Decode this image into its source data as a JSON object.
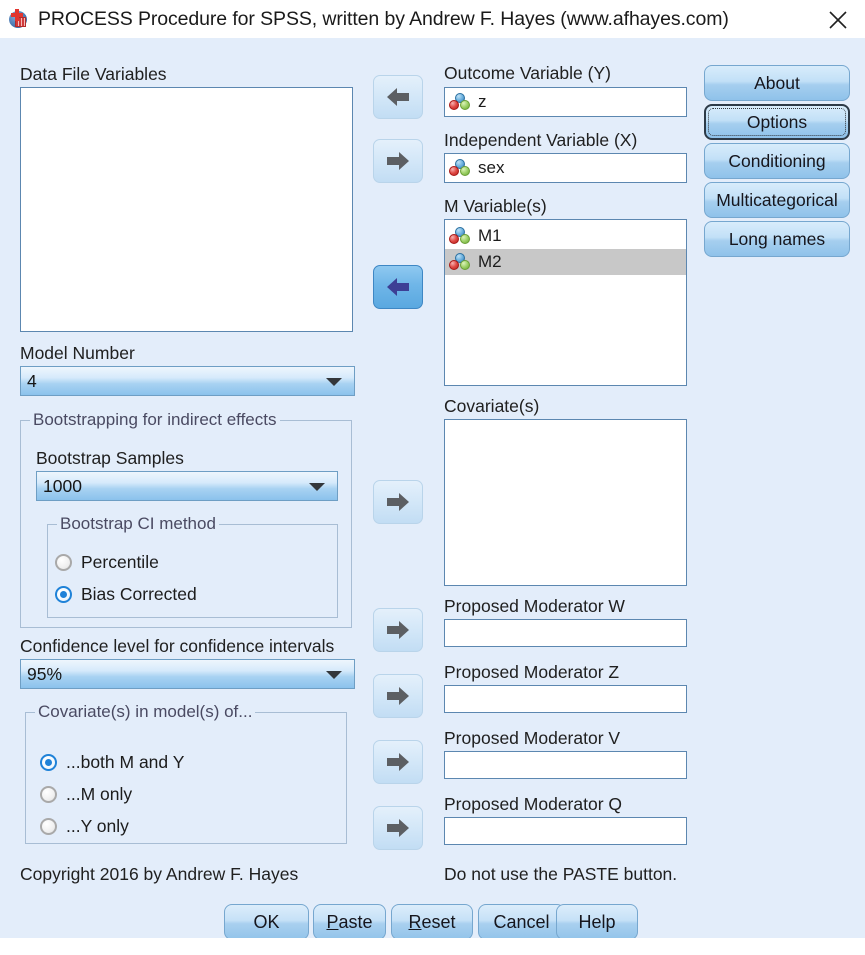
{
  "window": {
    "title": "PROCESS Procedure for SPSS, written by Andrew F. Hayes (www.afhayes.com)",
    "app_icon": "spss-app-icon",
    "close_icon": "close-icon"
  },
  "left_panel": {
    "data_file_variables_label": "Data File Variables",
    "data_file_variables_items": [],
    "model_number_label": "Model Number",
    "model_number_value": "4",
    "bootstrapping_group_label": "Bootstrapping for indirect effects",
    "bootstrap_samples_label": "Bootstrap Samples",
    "bootstrap_samples_value": "1000",
    "bootstrap_ci_group_label": "Bootstrap CI method",
    "bootstrap_ci_options": [
      {
        "label": "Percentile",
        "selected": false
      },
      {
        "label": "Bias Corrected",
        "selected": true
      }
    ],
    "confidence_level_label": "Confidence level for confidence intervals",
    "confidence_level_value": "95%",
    "covariates_group_label": "Covariate(s) in model(s) of...",
    "covariates_options": [
      {
        "label": "...both M and Y",
        "selected": true
      },
      {
        "label": "...M only",
        "selected": false
      },
      {
        "label": "...Y only",
        "selected": false
      }
    ],
    "copyright": "Copyright 2016 by Andrew F. Hayes"
  },
  "transfer_buttons": [
    {
      "name": "transfer-outcome-y",
      "direction": "left",
      "active": false
    },
    {
      "name": "transfer-independent-x",
      "direction": "right",
      "active": false
    },
    {
      "name": "transfer-m-variables",
      "direction": "left",
      "active": true
    },
    {
      "name": "transfer-covariates",
      "direction": "right",
      "active": false
    },
    {
      "name": "transfer-moderator-w",
      "direction": "right",
      "active": false
    },
    {
      "name": "transfer-moderator-z",
      "direction": "right",
      "active": false
    },
    {
      "name": "transfer-moderator-v",
      "direction": "right",
      "active": false
    },
    {
      "name": "transfer-moderator-q",
      "direction": "right",
      "active": false
    }
  ],
  "center_panel": {
    "outcome_label": "Outcome Variable (Y)",
    "outcome_value": "z",
    "independent_label": "Independent Variable (X)",
    "independent_value": "sex",
    "m_variables_label": "M Variable(s)",
    "m_variables_items": [
      {
        "name": "M1",
        "selected": false
      },
      {
        "name": "M2",
        "selected": true
      }
    ],
    "covariates_label": "Covariate(s)",
    "covariates_items": [],
    "moderator_w_label": "Proposed Moderator W",
    "moderator_w_value": "",
    "moderator_z_label": "Proposed Moderator Z",
    "moderator_z_value": "",
    "moderator_v_label": "Proposed Moderator V",
    "moderator_v_value": "",
    "moderator_q_label": "Proposed Moderator Q",
    "moderator_q_value": "",
    "paste_warning": "Do not use the PASTE button."
  },
  "side_buttons": [
    {
      "label": "About",
      "focused": false
    },
    {
      "label": "Options",
      "focused": true
    },
    {
      "label": "Conditioning",
      "focused": false
    },
    {
      "label": "Multicategorical",
      "focused": false
    },
    {
      "label": "Long names",
      "focused": false
    }
  ],
  "bottom_buttons": [
    {
      "label": "OK",
      "mnemonic": ""
    },
    {
      "label": "Paste",
      "mnemonic": "P"
    },
    {
      "label": "Reset",
      "mnemonic": "R"
    },
    {
      "label": "Cancel",
      "mnemonic": ""
    },
    {
      "label": "Help",
      "mnemonic": ""
    }
  ],
  "colors": {
    "dialog_background": "#e3edfa",
    "field_border": "#5c87b0",
    "selection_gray": "#c8c8c8",
    "accent_blue": "#1f82d8",
    "button_blue": "#a9d0ef"
  }
}
